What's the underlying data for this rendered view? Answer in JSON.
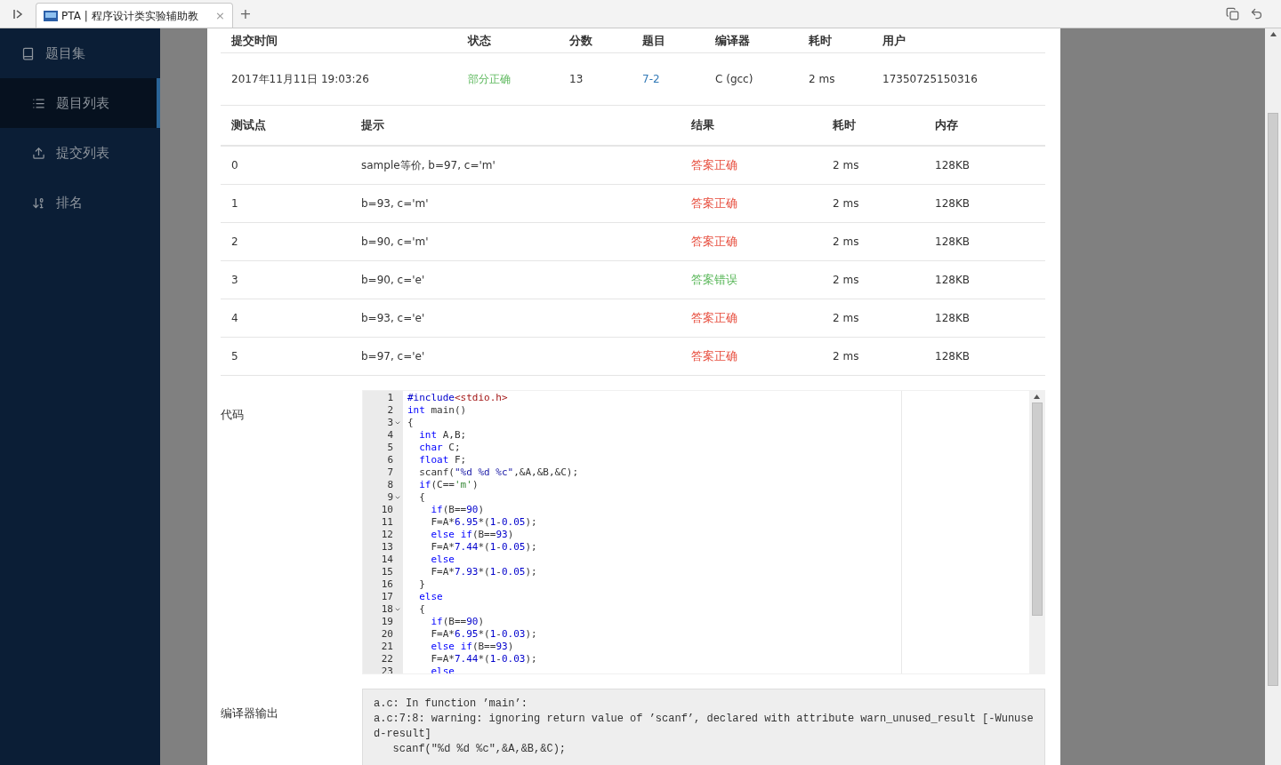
{
  "browser": {
    "tab_title": "PTA | 程序设计类实验辅助教",
    "close": "×",
    "new_tab": "+"
  },
  "sidebar": {
    "items": [
      {
        "label": "题目集",
        "selected": false
      },
      {
        "label": "题目列表",
        "selected": true
      },
      {
        "label": "提交列表",
        "selected": false
      },
      {
        "label": "排名",
        "selected": false
      }
    ]
  },
  "submission": {
    "columns": [
      "提交时间",
      "状态",
      "分数",
      "题目",
      "编译器",
      "耗时",
      "用户"
    ],
    "row": [
      {
        "text": "2017年11月11日 19:03:26",
        "kind": "text"
      },
      {
        "text": "部分正确",
        "kind": "status",
        "color": "#5cb85c"
      },
      {
        "text": "13",
        "kind": "text"
      },
      {
        "text": "7-2",
        "kind": "link"
      },
      {
        "text": "C (gcc)",
        "kind": "text"
      },
      {
        "text": "2 ms",
        "kind": "text"
      },
      {
        "text": "17350725150316",
        "kind": "text"
      }
    ]
  },
  "test_cases": {
    "columns": [
      "测试点",
      "提示",
      "结果",
      "耗时",
      "内存"
    ],
    "rows": [
      {
        "cells": [
          "0",
          "sample等价, b=97, c='m'",
          "答案正确",
          "2 ms",
          "128KB"
        ],
        "color": "#e74c3c"
      },
      {
        "cells": [
          "1",
          "b=93, c='m'",
          "答案正确",
          "2 ms",
          "128KB"
        ],
        "color": "#e74c3c"
      },
      {
        "cells": [
          "2",
          "b=90, c='m'",
          "答案正确",
          "2 ms",
          "128KB"
        ],
        "color": "#e74c3c"
      },
      {
        "cells": [
          "3",
          "b=90, c='e'",
          "答案错误",
          "2 ms",
          "128KB"
        ],
        "color": "#5cb85c"
      },
      {
        "cells": [
          "4",
          "b=93, c='e'",
          "答案正确",
          "2 ms",
          "128KB"
        ],
        "color": "#e74c3c"
      },
      {
        "cells": [
          "5",
          "b=97, c='e'",
          "答案正确",
          "2 ms",
          "128KB"
        ],
        "color": "#e74c3c"
      }
    ]
  },
  "code": {
    "label": "代码",
    "lines": [
      {
        "number": "1",
        "text": "#include<stdio.h>",
        "foldable": false
      },
      {
        "number": "2",
        "text": "int main()",
        "foldable": false
      },
      {
        "number": "3",
        "text": "{",
        "foldable": true
      },
      {
        "number": "4",
        "text": "  int A,B;",
        "foldable": false
      },
      {
        "number": "5",
        "text": "  char C;",
        "foldable": false
      },
      {
        "number": "6",
        "text": "  float F;",
        "foldable": false
      },
      {
        "number": "7",
        "text": "  scanf(\"%d %d %c\",&A,&B,&C);",
        "foldable": false
      },
      {
        "number": "8",
        "text": "  if(C=='m')",
        "foldable": false
      },
      {
        "number": "9",
        "text": "  {",
        "foldable": true
      },
      {
        "number": "10",
        "text": "    if(B==90)",
        "foldable": false
      },
      {
        "number": "11",
        "text": "    F=A*6.95*(1-0.05);",
        "foldable": false
      },
      {
        "number": "12",
        "text": "    else if(B==93)",
        "foldable": false
      },
      {
        "number": "13",
        "text": "    F=A*7.44*(1-0.05);",
        "foldable": false
      },
      {
        "number": "14",
        "text": "    else",
        "foldable": false
      },
      {
        "number": "15",
        "text": "    F=A*7.93*(1-0.05);",
        "foldable": false
      },
      {
        "number": "16",
        "text": "  }",
        "foldable": false
      },
      {
        "number": "17",
        "text": "  else",
        "foldable": false
      },
      {
        "number": "18",
        "text": "  {",
        "foldable": true
      },
      {
        "number": "19",
        "text": "    if(B==90)",
        "foldable": false
      },
      {
        "number": "20",
        "text": "    F=A*6.95*(1-0.03);",
        "foldable": false
      },
      {
        "number": "21",
        "text": "    else if(B==93)",
        "foldable": false
      },
      {
        "number": "22",
        "text": "    F=A*7.44*(1-0.03);",
        "foldable": false
      },
      {
        "number": "23",
        "text": "    else",
        "foldable": false
      }
    ]
  },
  "compiler_output": {
    "label": "编译器输出",
    "lines": [
      "a.c: In function ’main’:",
      "a.c:7:8: warning: ignoring return value of ’scanf’, declared with attribute warn_unused_result [-Wunused-result]",
      "   scanf(″%d %d %c″,&A,&B,&C);"
    ]
  }
}
